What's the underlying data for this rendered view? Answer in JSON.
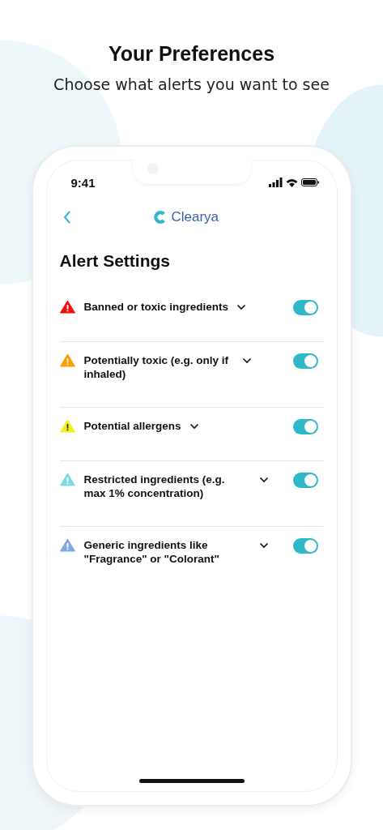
{
  "header": {
    "title": "Your Preferences",
    "subtitle": "Choose what alerts you want to see"
  },
  "status_bar": {
    "time": "9:41"
  },
  "nav": {
    "brand": "Clearya"
  },
  "screen_title": "Alert Settings",
  "alerts": [
    {
      "label": "Banned or toxic ingredients",
      "color": "#f01010",
      "on": true
    },
    {
      "label": "Potentially toxic (e.g. only if inhaled)",
      "color": "#ff9c00",
      "on": true
    },
    {
      "label": "Potential allergens",
      "color": "#f2f21a",
      "on": true
    },
    {
      "label": "Restricted ingredients (e.g. max 1% concentration)",
      "color": "#7ddbe3",
      "on": true
    },
    {
      "label": "Generic ingredients like \"Fragrance\" or \"Colorant\"",
      "color": "#7fa8e0",
      "on": true
    }
  ]
}
